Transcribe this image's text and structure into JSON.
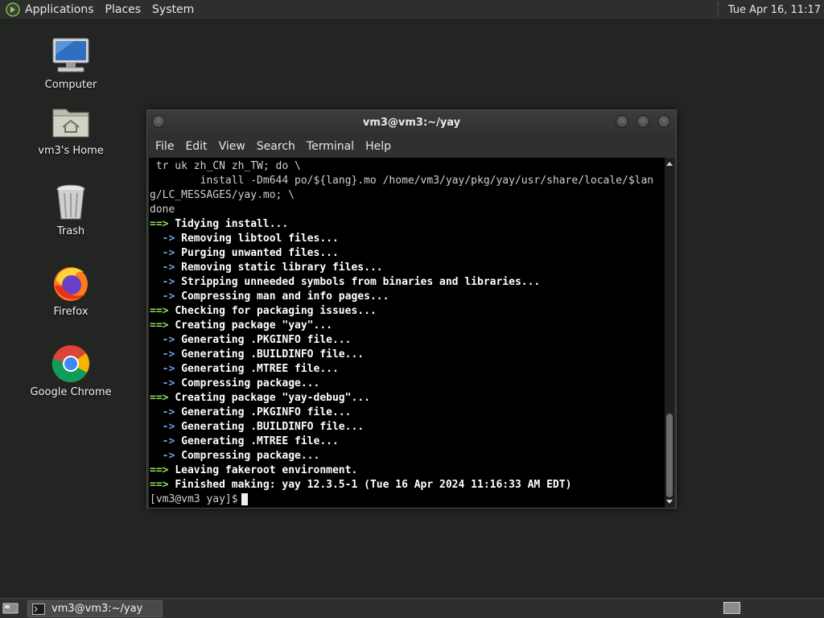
{
  "top_panel": {
    "menus": [
      "Applications",
      "Places",
      "System"
    ],
    "clock": "Tue Apr 16, 11:17"
  },
  "desktop_icons": [
    {
      "label": "Computer",
      "icon": "computer-icon"
    },
    {
      "label": "vm3's Home",
      "icon": "home-folder-icon"
    },
    {
      "label": "Trash",
      "icon": "trash-icon"
    },
    {
      "label": "Firefox",
      "icon": "firefox-icon"
    },
    {
      "label": "Google Chrome",
      "icon": "chrome-icon"
    }
  ],
  "terminal": {
    "title": "vm3@vm3:~/yay",
    "menu": [
      "File",
      "Edit",
      "View",
      "Search",
      "Terminal",
      "Help"
    ],
    "lines": [
      {
        "t": "plain",
        "text": " tr uk zh_CN zh_TW; do \\"
      },
      {
        "t": "plain",
        "text": "        install -Dm644 po/${lang}.mo /home/vm3/yay/pkg/yay/usr/share/locale/$lan"
      },
      {
        "t": "plain",
        "text": "g/LC_MESSAGES/yay.mo; \\"
      },
      {
        "t": "plain",
        "text": "done"
      },
      {
        "t": "main",
        "text": "Tidying install..."
      },
      {
        "t": "sub",
        "text": "Removing libtool files..."
      },
      {
        "t": "sub",
        "text": "Purging unwanted files..."
      },
      {
        "t": "sub",
        "text": "Removing static library files..."
      },
      {
        "t": "sub",
        "text": "Stripping unneeded symbols from binaries and libraries..."
      },
      {
        "t": "sub",
        "text": "Compressing man and info pages..."
      },
      {
        "t": "main",
        "text": "Checking for packaging issues..."
      },
      {
        "t": "main",
        "text": "Creating package \"yay\"..."
      },
      {
        "t": "sub",
        "text": "Generating .PKGINFO file..."
      },
      {
        "t": "sub",
        "text": "Generating .BUILDINFO file..."
      },
      {
        "t": "sub",
        "text": "Generating .MTREE file..."
      },
      {
        "t": "sub",
        "text": "Compressing package..."
      },
      {
        "t": "main",
        "text": "Creating package \"yay-debug\"..."
      },
      {
        "t": "sub",
        "text": "Generating .PKGINFO file..."
      },
      {
        "t": "sub",
        "text": "Generating .BUILDINFO file..."
      },
      {
        "t": "sub",
        "text": "Generating .MTREE file..."
      },
      {
        "t": "sub",
        "text": "Compressing package..."
      },
      {
        "t": "main",
        "text": "Leaving fakeroot environment."
      },
      {
        "t": "main",
        "text": "Finished making: yay 12.3.5-1 (Tue 16 Apr 2024 11:16:33 AM EDT)"
      }
    ],
    "prompt": "[vm3@vm3 yay]$",
    "main_marker": "==> ",
    "sub_marker": "  -> "
  },
  "taskbar": {
    "task_label": "vm3@vm3:~/yay"
  },
  "colors": {
    "arrow_green": "#8fe05a",
    "arrow_blue": "#6aa0e8",
    "terminal_bg": "#000000",
    "desktop_bg": "#232522"
  }
}
